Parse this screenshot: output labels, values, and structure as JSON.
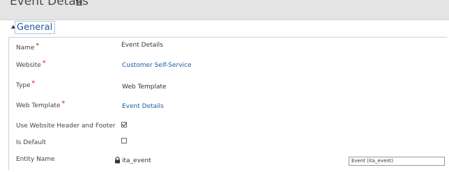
{
  "header": {
    "title": "Event Details"
  },
  "section": {
    "title": "General"
  },
  "fields": {
    "name": {
      "label": "Name",
      "value": "Event Details",
      "required": true
    },
    "website": {
      "label": "Website",
      "value": "Customer Self-Service",
      "required": true
    },
    "type": {
      "label": "Type",
      "value": "Web Template",
      "required": true
    },
    "web_template": {
      "label": "Web Template",
      "value": "Event Details",
      "required": true
    },
    "use_header_footer": {
      "label": "Use Website Header and Footer",
      "checked": true
    },
    "is_default": {
      "label": "Is Default",
      "checked": false
    },
    "entity_name": {
      "label": "Entity Name",
      "value": "ita_event",
      "dropdown_value": "Event (ita_event)"
    }
  },
  "required_mark": "*",
  "colors": {
    "header_bg": "#e4e4e4",
    "link": "#1a5aa6",
    "required": "#cc0000",
    "section_title": "#1e5a9c"
  },
  "icons": {
    "header_menu": "list-menu-icon",
    "collapse": "collapse-triangle-icon",
    "lock": "lock-icon"
  }
}
